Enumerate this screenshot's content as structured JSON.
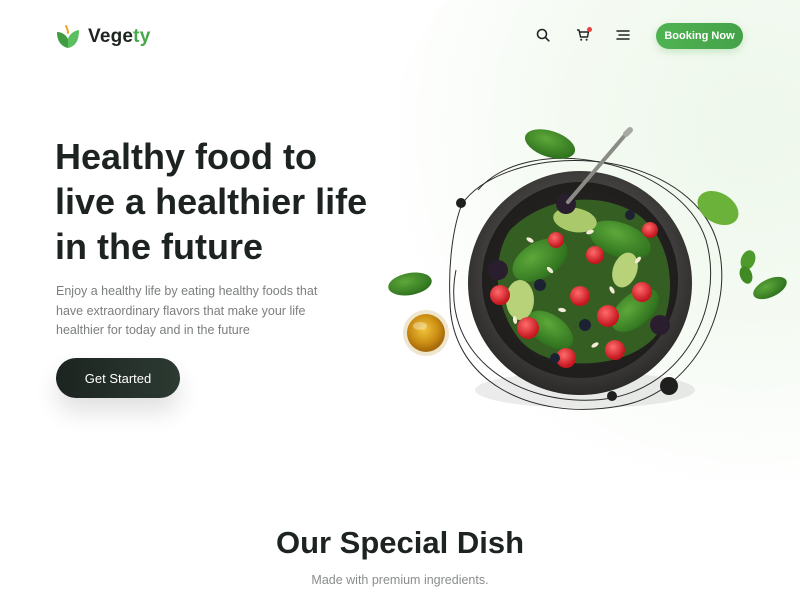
{
  "brand": {
    "name_main": "Vege",
    "name_accent": "ty",
    "accent_color": "#47a84a"
  },
  "header": {
    "icons": [
      "search-icon",
      "cart-icon",
      "menu-icon"
    ],
    "booking_label": "Booking Now"
  },
  "hero": {
    "title_lines": [
      "Healthy food to",
      "live a healthier life",
      "in the future"
    ],
    "subtitle_lines": [
      "Enjoy a healthy life by eating healthy foods that",
      "have extraordinary flavors that make your life",
      "healthier for today and in the future"
    ],
    "cta_label": "Get Started"
  },
  "section": {
    "title": "Our Special Dish",
    "subtitle": "Made with premium ingredients."
  },
  "colors": {
    "primary_green": "#4caf50",
    "dark": "#1d2320",
    "muted_text": "#7b7f7c"
  }
}
